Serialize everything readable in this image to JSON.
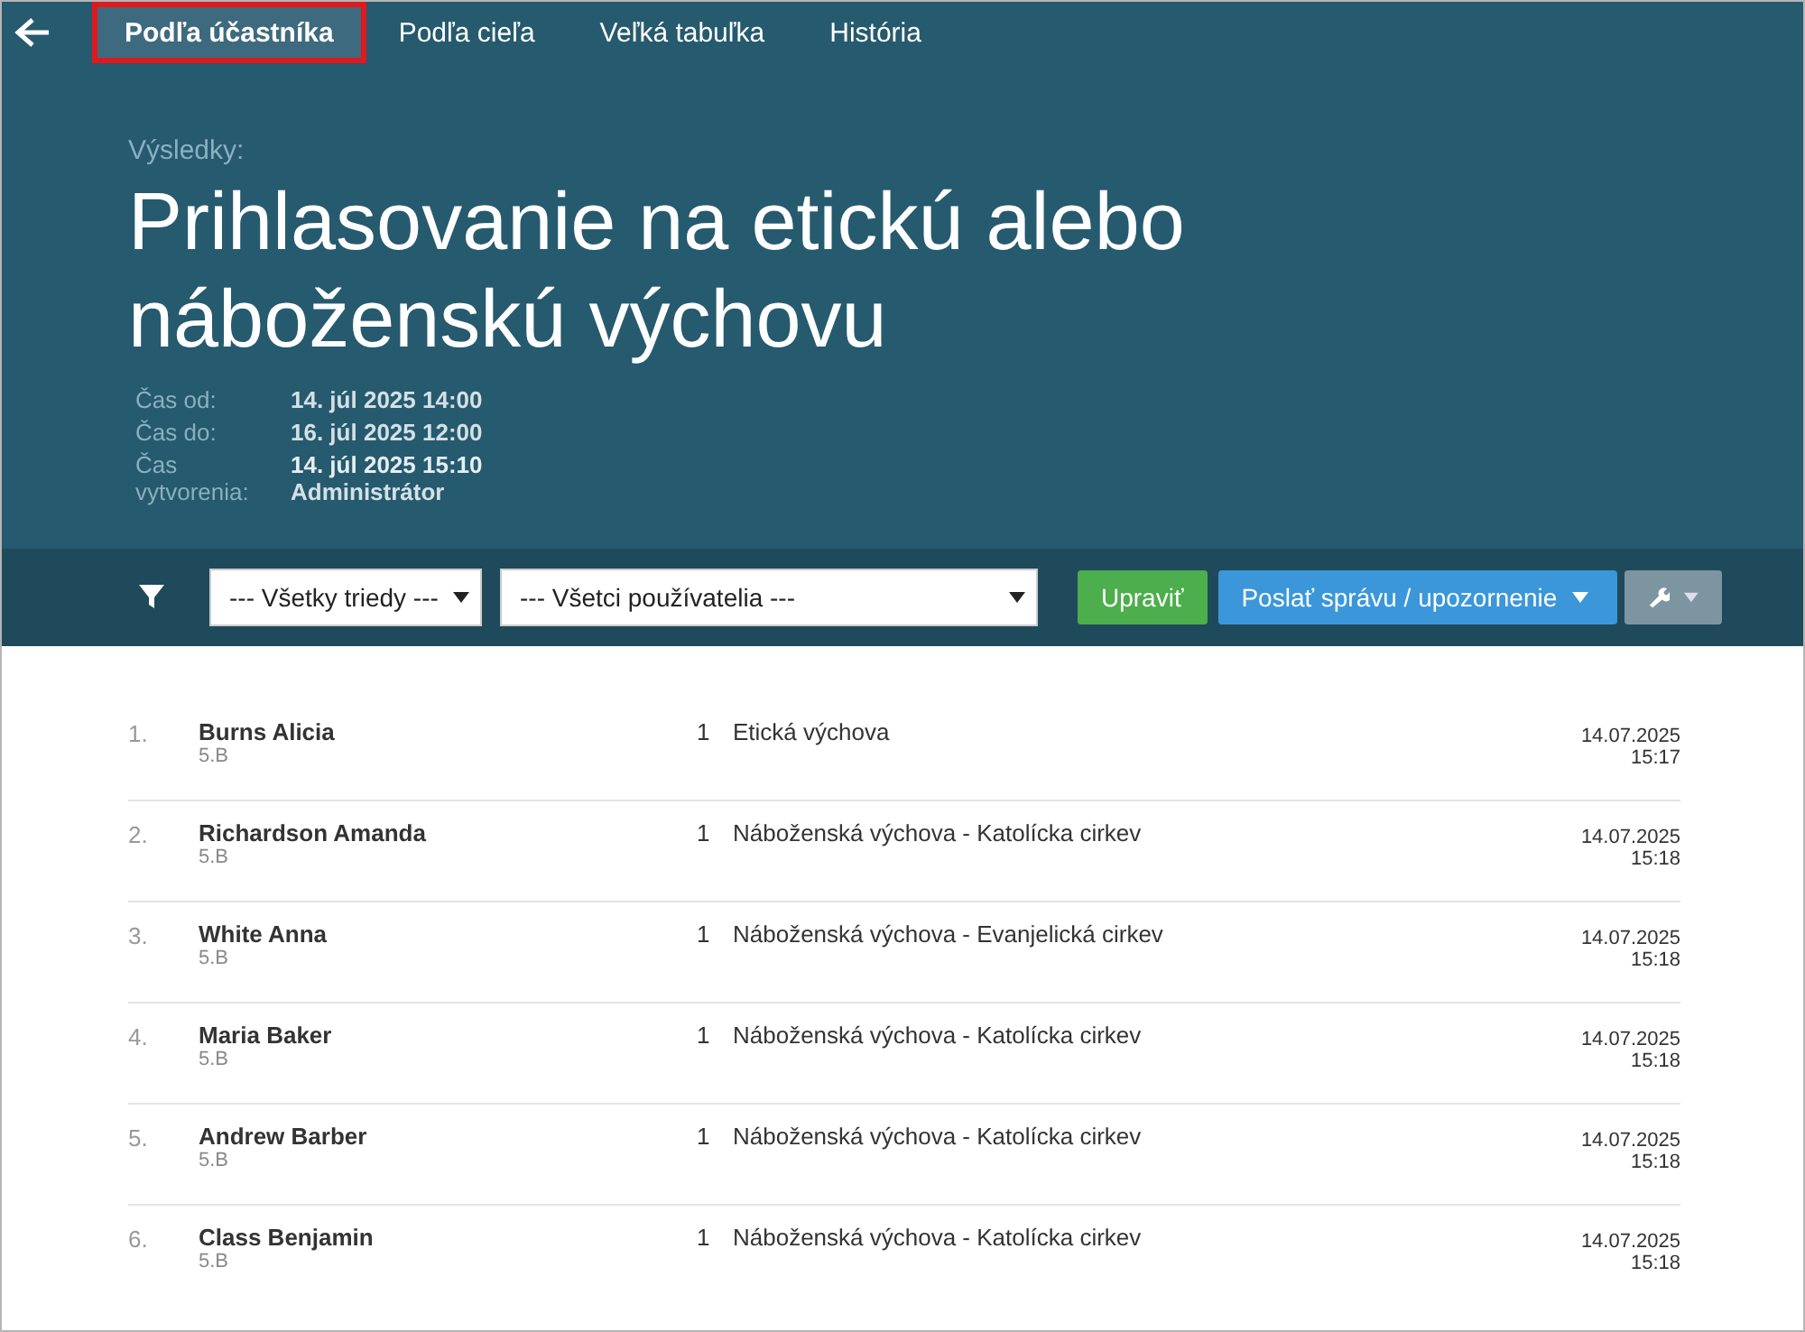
{
  "back": {
    "kind": "back"
  },
  "tabs": [
    {
      "label": "Podľa účastníka",
      "selected": true,
      "annotated": true
    },
    {
      "label": "Podľa cieľa",
      "selected": false,
      "annotated": false
    },
    {
      "label": "Veľká tabuľka",
      "selected": false,
      "annotated": false
    },
    {
      "label": "História",
      "selected": false,
      "annotated": false
    }
  ],
  "header": {
    "subtitle": "Výsledky:",
    "title": "Prihlasovanie na etickú alebo náboženskú výchovu",
    "meta": [
      {
        "label": "Čas od:",
        "value": "14. júl 2025 14:00"
      },
      {
        "label": "Čas do:",
        "value": "16. júl 2025 12:00"
      },
      {
        "label": "Čas vytvorenia:",
        "value": "14. júl 2025 15:10",
        "value2": "Administrátor"
      }
    ]
  },
  "toolbar": {
    "class_select": "--- Všetky triedy ---",
    "user_select": "--- Všetci používatelia ---",
    "edit_button": "Upraviť",
    "send_button": "Poslať správu / upozornenie"
  },
  "rows": [
    {
      "index": "1.",
      "name": "Burns Alicia",
      "class": "5.B",
      "count": "1",
      "choice": "Etická výchova",
      "date": "14.07.2025",
      "time": "15:17"
    },
    {
      "index": "2.",
      "name": "Richardson Amanda",
      "class": "5.B",
      "count": "1",
      "choice": "Náboženská výchova - Katolícka cirkev",
      "date": "14.07.2025",
      "time": "15:18"
    },
    {
      "index": "3.",
      "name": "White Anna",
      "class": "5.B",
      "count": "1",
      "choice": "Náboženská výchova - Evanjelická cirkev",
      "date": "14.07.2025",
      "time": "15:18"
    },
    {
      "index": "4.",
      "name": "Maria Baker",
      "class": "5.B",
      "count": "1",
      "choice": "Náboženská výchova - Katolícka cirkev",
      "date": "14.07.2025",
      "time": "15:18"
    },
    {
      "index": "5.",
      "name": "Andrew Barber",
      "class": "5.B",
      "count": "1",
      "choice": "Náboženská výchova - Katolícka cirkev",
      "date": "14.07.2025",
      "time": "15:18"
    },
    {
      "index": "6.",
      "name": "Class Benjamin",
      "class": "5.B",
      "count": "1",
      "choice": "Náboženská výchova - Katolícka cirkev",
      "date": "14.07.2025",
      "time": "15:18"
    }
  ]
}
